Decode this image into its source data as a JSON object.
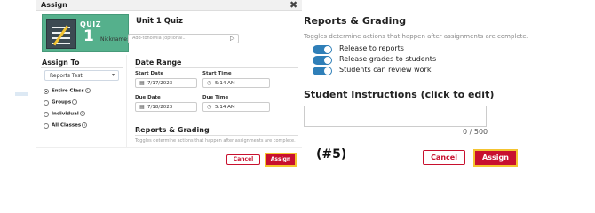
{
  "modal": {
    "title": "Assign",
    "close_glyph": "✖",
    "quiz_card": {
      "label": "QUIZ",
      "number": "1",
      "image_icon": "quiz-notebook-icon"
    },
    "quiz_title": "Unit 1 Quiz",
    "nickname": {
      "label": "Nickname:",
      "placeholder": "Add-tonowlia (optional...",
      "send_icon": "▷"
    },
    "assign_to": {
      "heading": "Assign To",
      "select_value": "Reports Test",
      "select_caret": "▾",
      "options": [
        {
          "label": "Entire Class",
          "selected": true
        },
        {
          "label": "Groups",
          "selected": false
        },
        {
          "label": "Individual",
          "selected": false
        },
        {
          "label": "All Classes",
          "selected": false
        }
      ],
      "info_glyph": "i"
    },
    "date_range": {
      "heading": "Date Range",
      "start_date_label": "Start Date",
      "start_date_value": "7/17/2023",
      "start_time_label": "Start Time",
      "start_time_value": "5:14 AM",
      "due_date_label": "Due Date",
      "due_date_value": "7/18/2023",
      "due_time_label": "Due Time",
      "due_time_value": "5:14 AM",
      "calendar_icon": "▦",
      "clock_icon": "◷"
    },
    "reports_grading": {
      "heading": "Reports & Grading",
      "description": "Toggles determine actions that happen after assignments are complete."
    },
    "buttons": {
      "cancel": "Cancel",
      "assign": "Assign"
    }
  },
  "step_label": "(#5)",
  "panel": {
    "title": "Reports & Grading",
    "description": "Toggles determine actions that happen after assignments are complete.",
    "toggles": [
      {
        "label": "Release to reports",
        "on": true
      },
      {
        "label": "Release grades to students",
        "on": true
      },
      {
        "label": "Students can review work",
        "on": true
      }
    ],
    "instructions_heading": "Student Instructions (click to edit)",
    "char_count": "0 / 500",
    "buttons": {
      "cancel": "Cancel",
      "assign": "Assign"
    }
  },
  "colors": {
    "accent_red": "#c8102e",
    "highlight_yellow": "#f4c430",
    "toggle_blue": "#2f7fb8",
    "quiz_green": "#55b08c"
  }
}
